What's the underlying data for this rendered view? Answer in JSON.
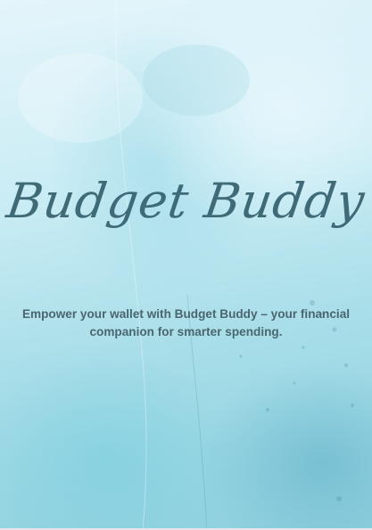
{
  "title": "Budget Buddy",
  "tagline": {
    "line1": "Empower your wallet with Budget Buddy – your financial",
    "line2": "companion for smarter spending."
  },
  "colors": {
    "title": "#3f6a78",
    "tagline": "#4a6670",
    "watercolor_light": "#e4f5fb",
    "watercolor_mid": "#a6dde8",
    "watercolor_dark": "#8fd0de"
  }
}
